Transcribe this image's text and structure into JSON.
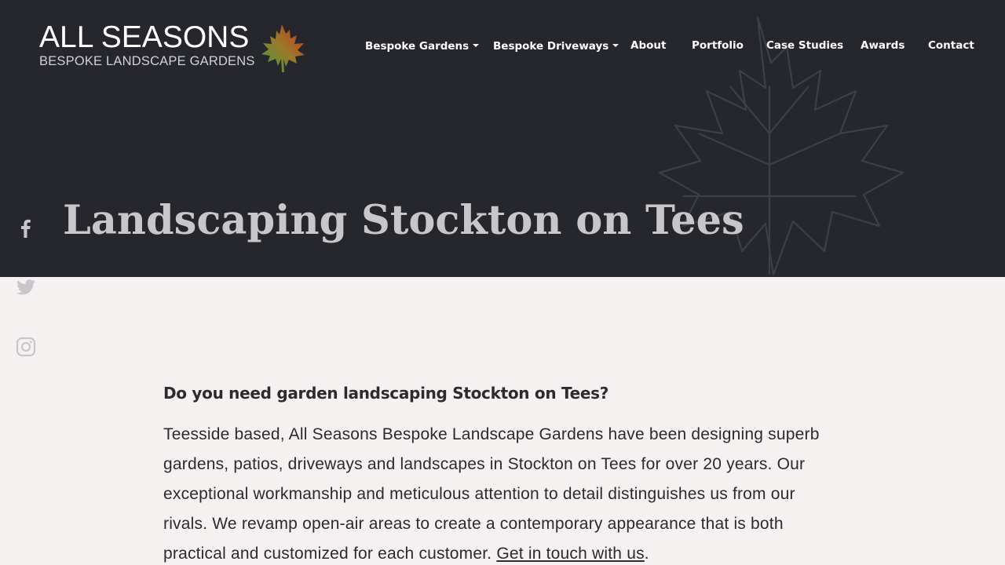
{
  "brand": {
    "title": "ALL SEASONS",
    "subtitle": "BESPOKE LANDSCAPE GARDENS"
  },
  "nav": {
    "items": [
      {
        "label": "Bespoke Gardens",
        "dropdown": true
      },
      {
        "label": "Bespoke Driveways",
        "dropdown": true
      },
      {
        "label": "About",
        "dropdown": false
      },
      {
        "label": "Portfolio",
        "dropdown": false
      },
      {
        "label": "Case Studies",
        "dropdown": false
      },
      {
        "label": "Awards",
        "dropdown": false
      },
      {
        "label": "Contact",
        "dropdown": false
      }
    ]
  },
  "hero": {
    "title": "Landscaping Stockton on Tees"
  },
  "social": [
    {
      "icon": "facebook-icon"
    },
    {
      "icon": "twitter-icon"
    },
    {
      "icon": "instagram-icon"
    }
  ],
  "content": {
    "heading": "Do you need garden landscaping Stockton on Tees?",
    "paragraph": "Teesside based, All Seasons Bespoke Landscape Gardens have been designing superb gardens, patios, driveways and landscapes in Stockton on Tees for over 20 years. Our exceptional workmanship and meticulous attention to detail distinguishes us from our rivals. We revamp open-air areas to create a contemporary appearance that is both practical and customized for each customer.",
    "link": "Get in touch with us",
    "after_link": "."
  },
  "colors": {
    "hero_bg": "#26262d",
    "page_bg": "#f6f1f1",
    "nav_text": "#ffffff",
    "title_text": "#c9c6ca",
    "body_text": "#2a2a2f",
    "social_icon": "#c7c6cc"
  }
}
